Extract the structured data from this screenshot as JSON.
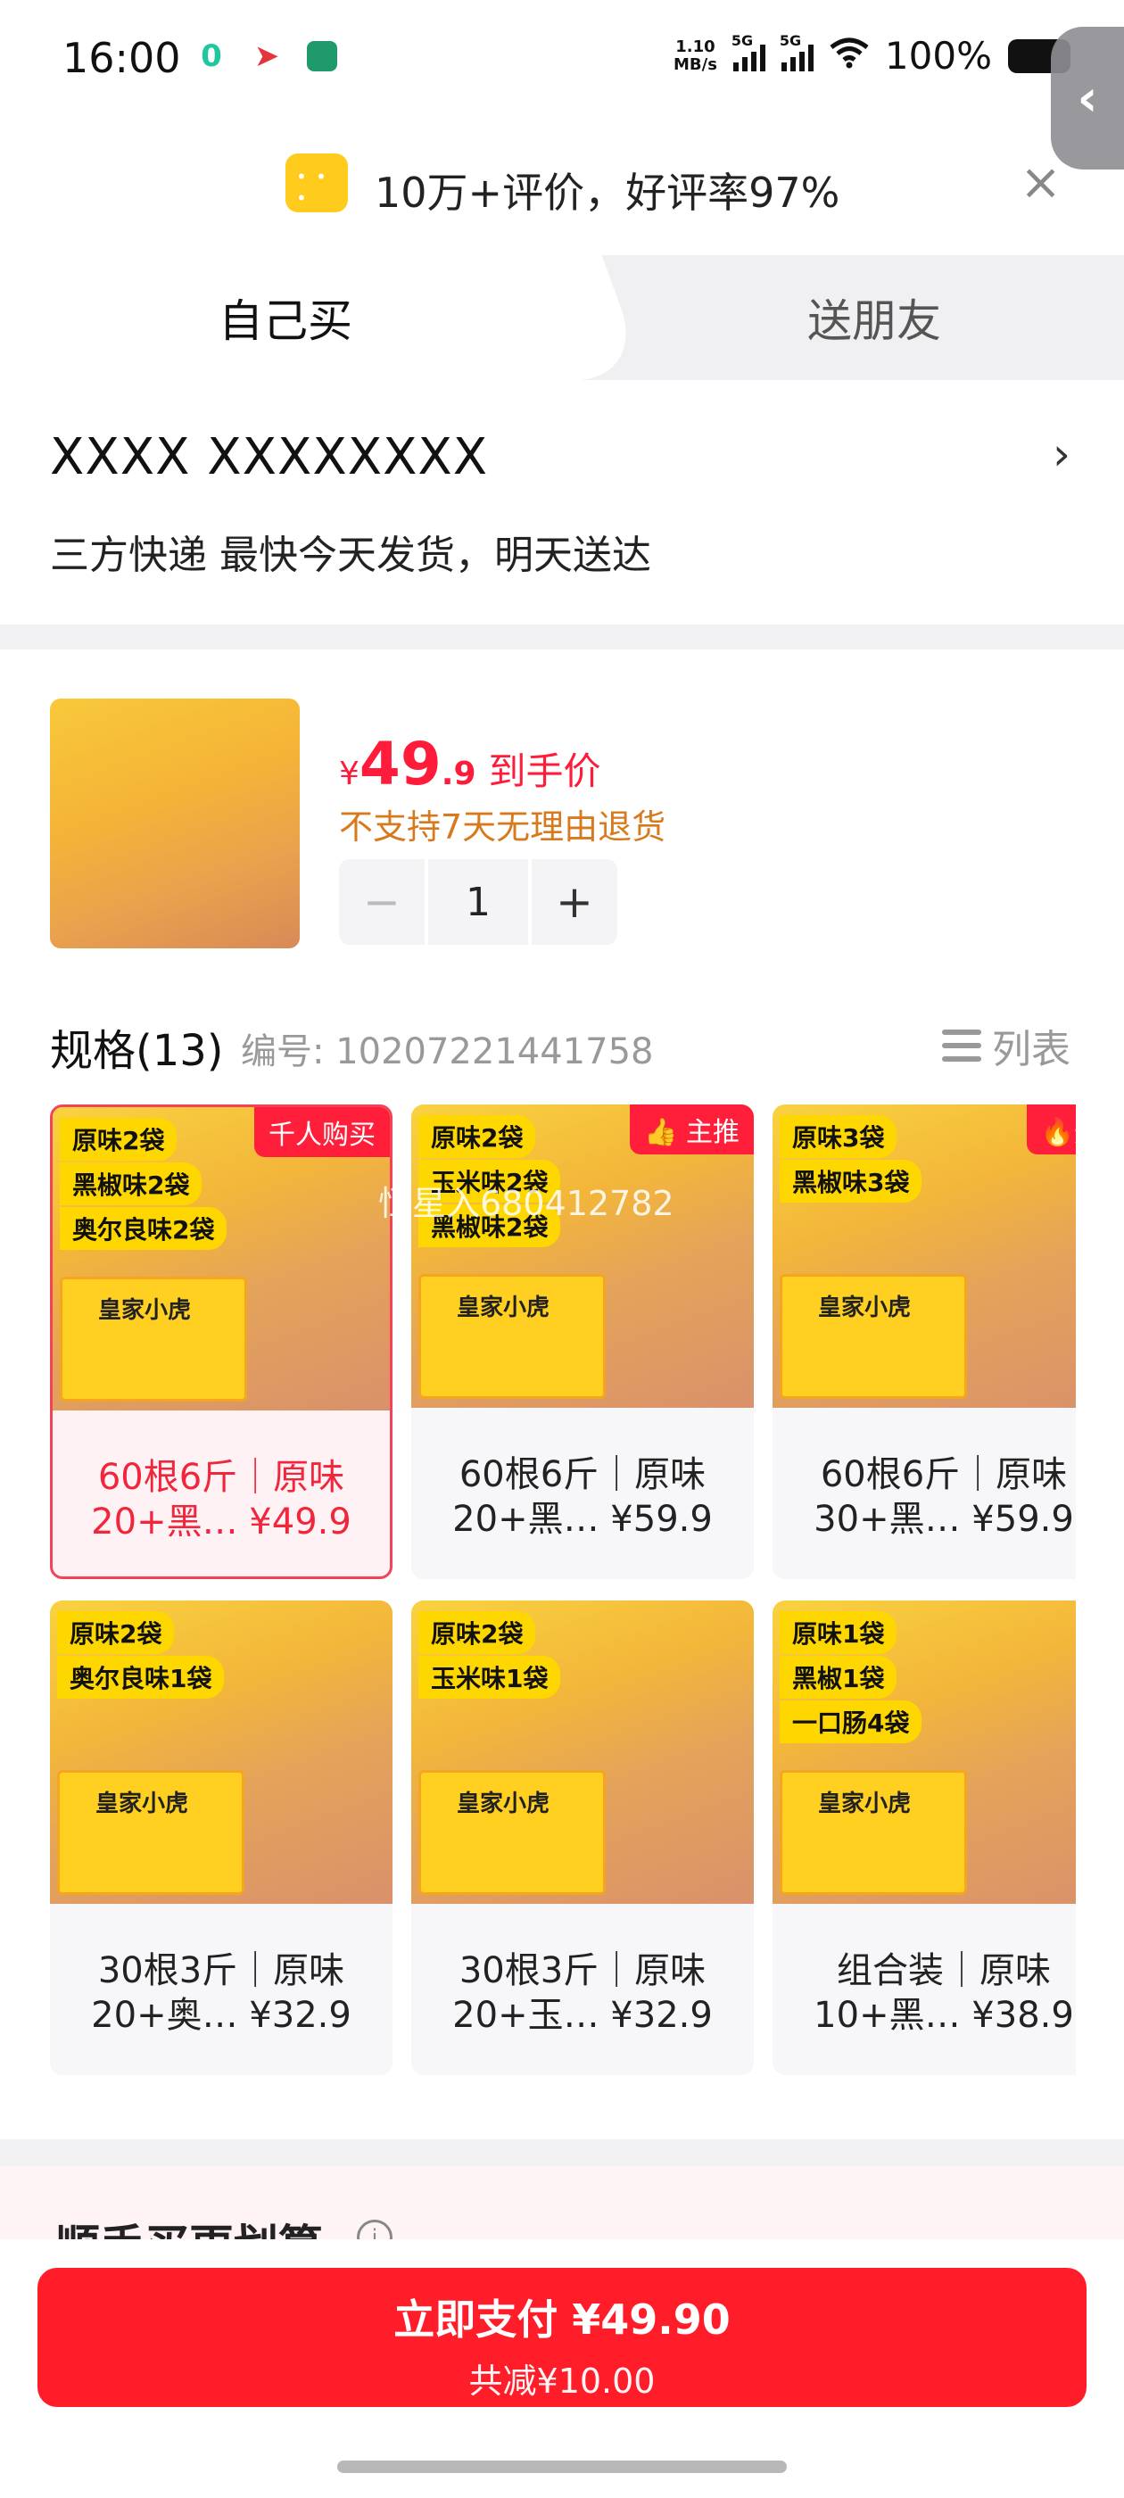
{
  "status_bar": {
    "time": "16:00",
    "net_speed_top": "1.10",
    "net_speed_bottom": "MB/s",
    "sig1": "5G",
    "sig2": "5G",
    "battery": "100%"
  },
  "rating_banner": {
    "text": "10万+评价，好评率97%",
    "close": "×"
  },
  "tabs": {
    "self": "自己买",
    "gift": "送朋友"
  },
  "address": {
    "name": "XXXX  XXXXXXXX",
    "shipping": "三方快递 最快今天发货，明天送达",
    "chevron": "›"
  },
  "product": {
    "currency": "¥",
    "price_int": "49",
    "price_dec": ".9",
    "price_tag": "到手价",
    "no_return": "不支持7天无理由退货",
    "quantity": "1",
    "minus": "−",
    "plus": "+"
  },
  "spec": {
    "title": "规格(13)",
    "code": "编号: 10207221441758",
    "list_label": "列表",
    "cards": [
      {
        "labels": [
          "原味2袋",
          "黑椒味2袋",
          "奥尔良味2袋"
        ],
        "badge": "千人购买",
        "line1": "60根6斤｜原味",
        "line2": "20+黑…  ¥49.9",
        "selected": true
      },
      {
        "labels": [
          "原味2袋",
          "玉米味2袋",
          "黑椒味2袋"
        ],
        "badge": "主推",
        "line1": "60根6斤｜原味",
        "line2": "20+黑…  ¥59.9",
        "selected": false
      },
      {
        "labels": [
          "原味3袋",
          "黑椒味3袋"
        ],
        "badge": "热",
        "line1": "60根6斤｜原味",
        "line2": "30+黑…  ¥59.9",
        "selected": false
      },
      {
        "labels": [
          "原味2袋",
          "奥尔良味1袋"
        ],
        "badge": "",
        "line1": "30根3斤｜原味",
        "line2": "20+奥…  ¥32.9",
        "selected": false
      },
      {
        "labels": [
          "原味2袋",
          "玉米味1袋"
        ],
        "badge": "",
        "line1": "30根3斤｜原味",
        "line2": "20+玉…  ¥32.9",
        "selected": false
      },
      {
        "labels": [
          "原味1袋",
          "黑椒1袋",
          "一口肠4袋"
        ],
        "badge": "",
        "line1": "组合装｜原味",
        "line2": "10+黑…  ¥38.9",
        "selected": false
      }
    ]
  },
  "watermark": "恒星入680412782",
  "bundle": {
    "title": "顺手买更划算",
    "info": "i"
  },
  "pay": {
    "main": "立即支付 ¥49.90",
    "sub": "共减¥10.00"
  },
  "side_tab": "‹"
}
